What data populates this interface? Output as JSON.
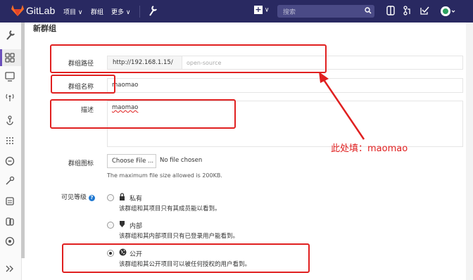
{
  "topbar": {
    "brand": "GitLab",
    "nav": [
      "项目 ∨",
      "群组",
      "更多 ∨"
    ],
    "plus_label": "∨",
    "search_placeholder": "搜索"
  },
  "page": {
    "title": "新群组"
  },
  "form": {
    "path_label": "群组路径",
    "path_prefix": "http://192.168.1.15/",
    "path_placeholder": "open-source",
    "name_label": "群组名称",
    "name_value": "maomao",
    "desc_label": "描述",
    "desc_value": "maomao",
    "avatar_label": "群组图标",
    "choose_file": "Choose File ...",
    "no_file": "No file chosen",
    "file_hint": "The maximum file size allowed is 200KB.",
    "visibility_label": "可见等级",
    "options": [
      {
        "name": "私有",
        "desc": "该群组和其项目只有其成员能以看到。"
      },
      {
        "name": "内部",
        "desc": "该群组和其内部项目只有已登录用户能看到。"
      },
      {
        "name": "公开",
        "desc": "该群组和其公开项目可以被任何授权的用户看到。"
      }
    ]
  },
  "annotation": "此处填：maomao",
  "colors": {
    "topbar": "#292961",
    "highlight": "#e02020"
  }
}
